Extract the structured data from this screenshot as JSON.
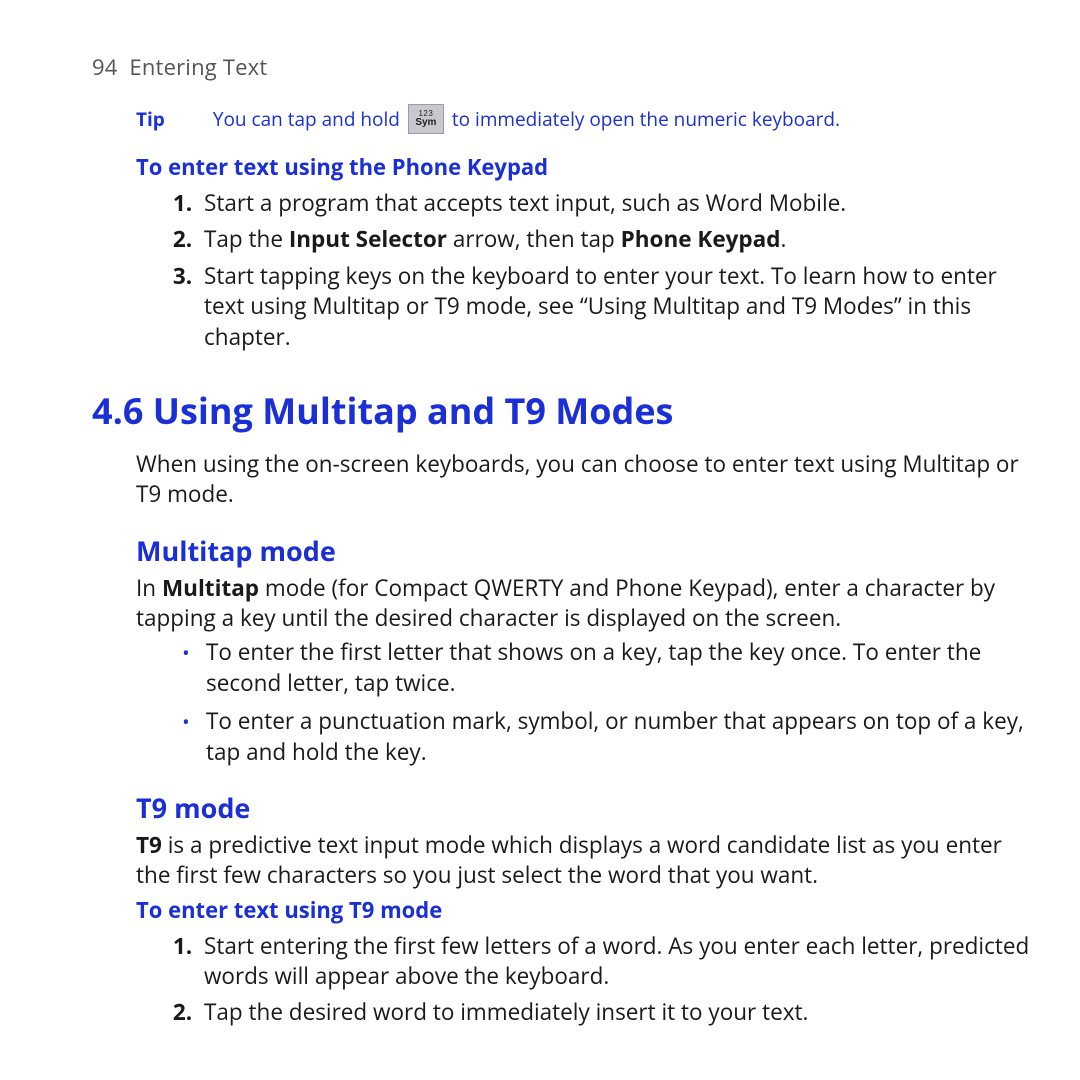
{
  "header": {
    "page_number": "94",
    "chapter": "Entering Text"
  },
  "tip": {
    "label": "Tip",
    "pre": "You can tap and hold",
    "key_top": "123",
    "key_bot": "Sym",
    "post": "to immediately open the numeric keyboard."
  },
  "proc1": {
    "title": "To enter text using the Phone Keypad",
    "s1": "Start a program that accepts text input, such as Word Mobile.",
    "s2_pre": "Tap the ",
    "s2_b1": "Input Selector",
    "s2_mid": " arrow, then tap ",
    "s2_b2": "Phone Keypad",
    "s2_post": ".",
    "s3": "Start tapping keys on the keyboard to enter your text. To learn how to enter text using Multitap or T9 mode, see “Using Multitap and T9 Modes” in this chapter."
  },
  "section": {
    "num": "4.6",
    "title": "Using Multitap and T9 Modes",
    "intro": "When using the on-screen keyboards, you can choose to enter text using Multitap or T9 mode."
  },
  "multitap": {
    "heading": "Multitap mode",
    "p_pre": "In ",
    "p_b": "Multitap",
    "p_post": " mode (for Compact QWERTY and Phone Keypad), enter a character by tapping a key until the desired character is displayed on the screen.",
    "b1": "To enter the first letter that shows on a key, tap the key once. To enter the second letter, tap twice.",
    "b2": "To enter a punctuation mark, symbol, or number that appears on top of a key, tap and hold the key."
  },
  "t9": {
    "heading": "T9 mode",
    "p_b": "T9",
    "p_post": " is a predictive text input mode which displays a word candidate list as you enter the first few characters so you just select the word that you want.",
    "proc_title": "To enter text using T9 mode",
    "s1": "Start entering the first few letters of a word. As you enter each letter, predicted words will appear above the keyboard.",
    "s2": "Tap the desired word to immediately insert it to your text."
  }
}
